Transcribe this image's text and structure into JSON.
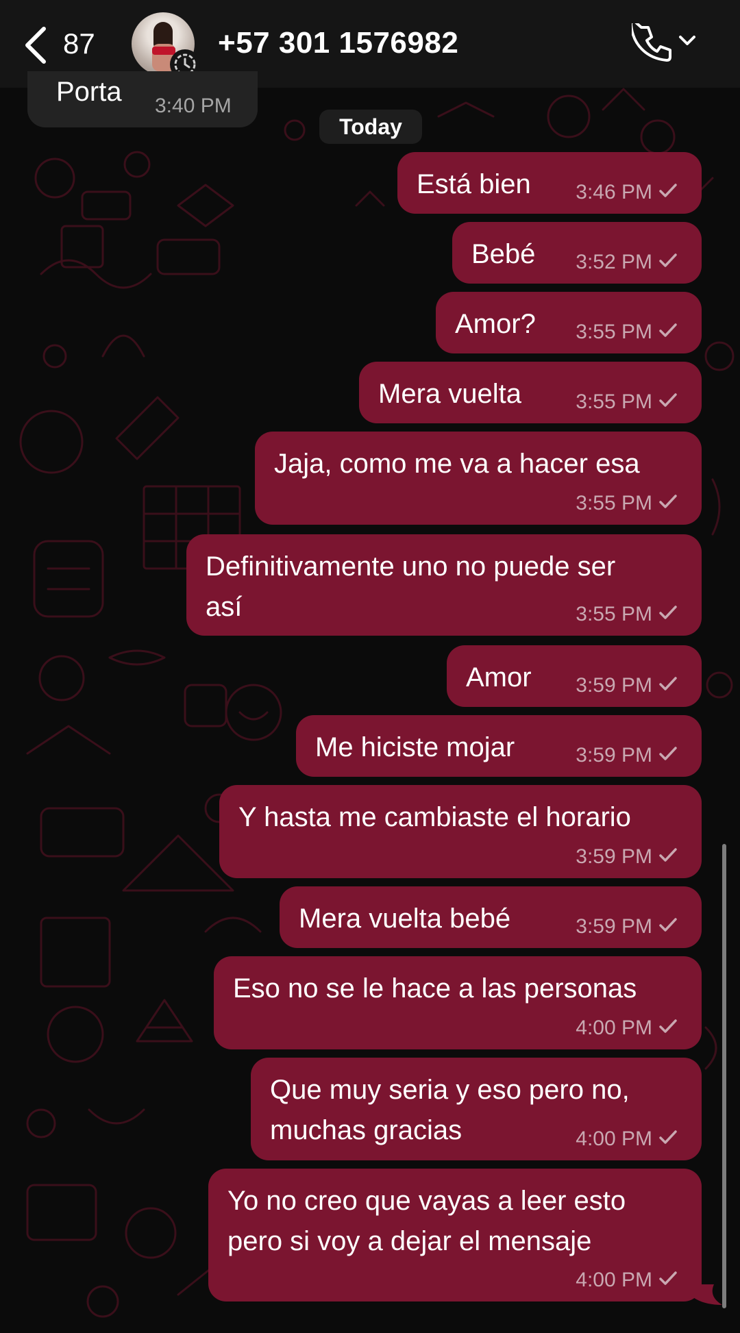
{
  "header": {
    "unread_count": "87",
    "contact_name": "+57 301 1576982"
  },
  "incoming": {
    "text": "Porta",
    "time": "3:40 PM"
  },
  "date_chip": "Today",
  "messages": [
    {
      "lines": [
        "Está bien"
      ],
      "time": "3:46 PM"
    },
    {
      "lines": [
        "Bebé"
      ],
      "time": "3:52 PM"
    },
    {
      "lines": [
        "Amor?"
      ],
      "time": "3:55 PM"
    },
    {
      "lines": [
        "Mera vuelta"
      ],
      "time": "3:55 PM"
    },
    {
      "lines": [
        "Jaja, como me va a hacer esa"
      ],
      "time": "3:55 PM"
    },
    {
      "lines": [
        "Definitivamente uno no puede ser",
        "así"
      ],
      "time": "3:55 PM"
    },
    {
      "lines": [
        "Amor"
      ],
      "time": "3:59 PM"
    },
    {
      "lines": [
        "Me hiciste mojar"
      ],
      "time": "3:59 PM"
    },
    {
      "lines": [
        "Y hasta me cambiaste el horario"
      ],
      "time": "3:59 PM"
    },
    {
      "lines": [
        "Mera vuelta bebé"
      ],
      "time": "3:59 PM"
    },
    {
      "lines": [
        "Eso no se le hace a las personas"
      ],
      "time": "4:00 PM"
    },
    {
      "lines": [
        "Que muy seria y eso pero no,",
        "muchas gracias"
      ],
      "time": "4:00 PM"
    },
    {
      "lines": [
        "Yo no creo que vayas a leer esto",
        "pero si voy a dejar el mensaje"
      ],
      "time": "4:00 PM"
    }
  ],
  "colors": {
    "outgoing_bubble": "#7b1530",
    "incoming_bubble": "#232323",
    "background": "#0b0b0b",
    "doodle": "#3a0f1a"
  }
}
